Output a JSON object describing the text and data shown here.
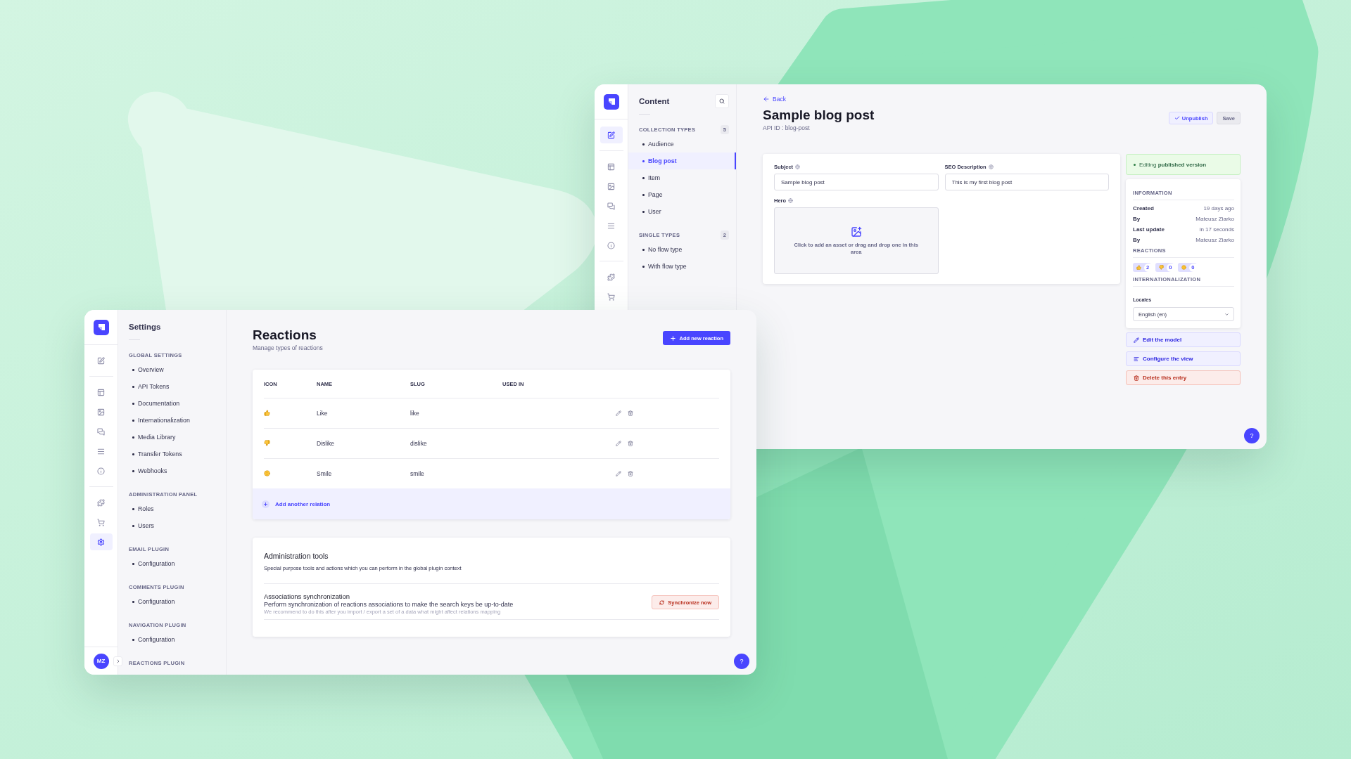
{
  "content_window": {
    "rail_groups": [
      {
        "items": [
          {
            "kind": "content",
            "selected": true
          }
        ]
      },
      {
        "items": [
          {
            "kind": "builder",
            "selected": false
          },
          {
            "kind": "media",
            "selected": false
          },
          {
            "kind": "comments",
            "selected": false
          },
          {
            "kind": "navigation",
            "selected": false
          },
          {
            "kind": "info",
            "selected": false
          }
        ]
      },
      {
        "items": [
          {
            "kind": "plugins",
            "selected": false
          },
          {
            "kind": "marketplace",
            "selected": false
          }
        ]
      }
    ],
    "nav": {
      "title": "Content",
      "search_button": true,
      "sections": [
        {
          "title": "COLLECTION TYPES",
          "count": "5",
          "items": [
            {
              "label": "Audience",
              "selected": false
            },
            {
              "label": "Blog post",
              "selected": true
            },
            {
              "label": "Item",
              "selected": false
            },
            {
              "label": "Page",
              "selected": false
            },
            {
              "label": "User",
              "selected": false
            }
          ]
        },
        {
          "title": "SINGLE TYPES",
          "count": "2",
          "items": [
            {
              "label": "No flow type",
              "selected": false
            },
            {
              "label": "With flow type",
              "selected": false
            }
          ]
        }
      ]
    },
    "back": "Back",
    "title": "Sample blog post",
    "api_id": "API ID : blog-post",
    "actions": [
      {
        "kind": "unpublish",
        "label": "Unpublish"
      },
      {
        "kind": "save",
        "label": "Save"
      }
    ],
    "fields": [
      {
        "label": "Subject",
        "value": "Sample blog post"
      },
      {
        "label": "SEO Description",
        "value": "This is my first blog post"
      }
    ],
    "media_field": {
      "label": "Hero",
      "hint": "Click to add an asset or drag and drop one in this area"
    },
    "status": "Editing **published version**",
    "information": {
      "title": "INFORMATION",
      "rows": [
        {
          "label": "Created",
          "value": "19 days ago"
        },
        {
          "label": "By",
          "value": "Mateusz Ziarko"
        },
        {
          "label": "Last update",
          "value": "in 17 seconds"
        },
        {
          "label": "By",
          "value": "Mateusz Ziarko"
        }
      ]
    },
    "reactions": {
      "title": "REACTIONS",
      "items": [
        {
          "kind": "thumbs-up",
          "count": "2"
        },
        {
          "kind": "thumbs-down",
          "count": "0"
        },
        {
          "kind": "smile",
          "count": "0"
        }
      ]
    },
    "i18n": {
      "title": "INTERNATIONALIZATION",
      "label": "Locales",
      "value": "English (en)"
    },
    "links": [
      {
        "kind": "edit",
        "label": "Edit the model"
      },
      {
        "kind": "configure",
        "label": "Configure the view"
      },
      {
        "kind": "delete",
        "label": "Delete this entry"
      }
    ],
    "help": "?"
  },
  "settings_window": {
    "rail_groups": [
      {
        "items": [
          {
            "kind": "content",
            "selected": false
          }
        ]
      },
      {
        "items": [
          {
            "kind": "builder",
            "selected": false
          },
          {
            "kind": "media",
            "selected": false
          },
          {
            "kind": "comments",
            "selected": false
          },
          {
            "kind": "navigation",
            "selected": false
          },
          {
            "kind": "info",
            "selected": false
          }
        ]
      },
      {
        "items": [
          {
            "kind": "plugins",
            "selected": false
          },
          {
            "kind": "marketplace",
            "selected": false
          },
          {
            "kind": "settings",
            "selected": true
          }
        ]
      }
    ],
    "avatar": "MZ",
    "nav": {
      "title": "Settings",
      "sections": [
        {
          "title": "GLOBAL SETTINGS",
          "items": [
            {
              "label": "Overview",
              "selected": false
            },
            {
              "label": "API Tokens",
              "selected": false
            },
            {
              "label": "Documentation",
              "selected": false
            },
            {
              "label": "Internationalization",
              "selected": false
            },
            {
              "label": "Media Library",
              "selected": false
            },
            {
              "label": "Transfer Tokens",
              "selected": false
            },
            {
              "label": "Webhooks",
              "selected": false
            }
          ]
        },
        {
          "title": "ADMINISTRATION PANEL",
          "items": [
            {
              "label": "Roles",
              "selected": false
            },
            {
              "label": "Users",
              "selected": false
            }
          ]
        },
        {
          "title": "EMAIL PLUGIN",
          "items": [
            {
              "label": "Configuration",
              "selected": false
            }
          ]
        },
        {
          "title": "COMMENTS PLUGIN",
          "items": [
            {
              "label": "Configuration",
              "selected": false
            }
          ]
        },
        {
          "title": "NAVIGATION PLUGIN",
          "items": [
            {
              "label": "Configuration",
              "selected": false
            }
          ]
        },
        {
          "title": "REACTIONS PLUGIN"
        }
      ]
    },
    "title": "Reactions",
    "subtitle": "Manage types of reactions",
    "add_button": "Add new reaction",
    "table": {
      "columns": [
        "ICON",
        "NAME",
        "SLUG",
        "USED IN"
      ],
      "rows": [
        {
          "kind": "thumbs-up",
          "name": "Like",
          "slug": "like"
        },
        {
          "kind": "thumbs-down",
          "name": "Dislike",
          "slug": "dislike"
        },
        {
          "kind": "smile",
          "name": "Smile",
          "slug": "smile"
        }
      ],
      "add_relation": "Add another relation"
    },
    "tools": {
      "title": "Administration tools",
      "description": "Special purpose tools and actions which you can perform in the global plugin context",
      "items": [
        {
          "title": "Associations synchronization",
          "description": "Perform synchronization of reactions associations to make the search keys be up-to-date",
          "hint": "We recommend to do this after you import / export a set of a data what might affect relations mapping",
          "button": "Synchronize now"
        }
      ]
    },
    "help": "?"
  }
}
